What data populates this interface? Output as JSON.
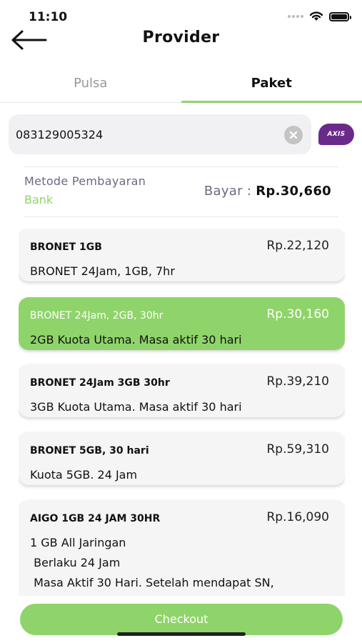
{
  "status_bar": {
    "time": "11:10"
  },
  "header": {
    "title": "Provider"
  },
  "tabs": [
    {
      "label": "Pulsa",
      "active": false
    },
    {
      "label": "Paket",
      "active": true
    }
  ],
  "phone": {
    "value": "083129005324",
    "provider": "AXIS"
  },
  "payment": {
    "label": "Metode Pembayaran",
    "method": "Bank",
    "total_label": "Bayar :",
    "total_value": "Rp.30,660"
  },
  "packages": [
    {
      "title": "BRONET 1GB",
      "price": "Rp.22,120",
      "desc": "BRONET 24Jam, 1GB, 7hr",
      "selected": false
    },
    {
      "title": "BRONET 24Jam, 2GB, 30hr",
      "price": "Rp.30,160",
      "desc": "2GB Kuota Utama. Masa aktif 30 hari",
      "selected": true
    },
    {
      "title": "BRONET 24Jam 3GB 30hr",
      "price": "Rp.39,210",
      "desc": "3GB Kuota Utama. Masa aktif 30 hari",
      "selected": false
    },
    {
      "title": "BRONET 5GB, 30 hari",
      "price": "Rp.59,310",
      "desc": "Kuota 5GB. 24 Jam",
      "selected": false
    },
    {
      "title": "AIGO 1GB 24 JAM 30HR",
      "price": "Rp.16,090",
      "desc": "1 GB All Jaringan\n Berlaku 24 Jam\n Masa Aktif 30 Hari. Setelah mendapat SN,",
      "selected": false
    }
  ],
  "checkout": {
    "label": "Checkout"
  },
  "colors": {
    "accent": "#8fd46a",
    "axis_brand": "#6a2a8c"
  }
}
